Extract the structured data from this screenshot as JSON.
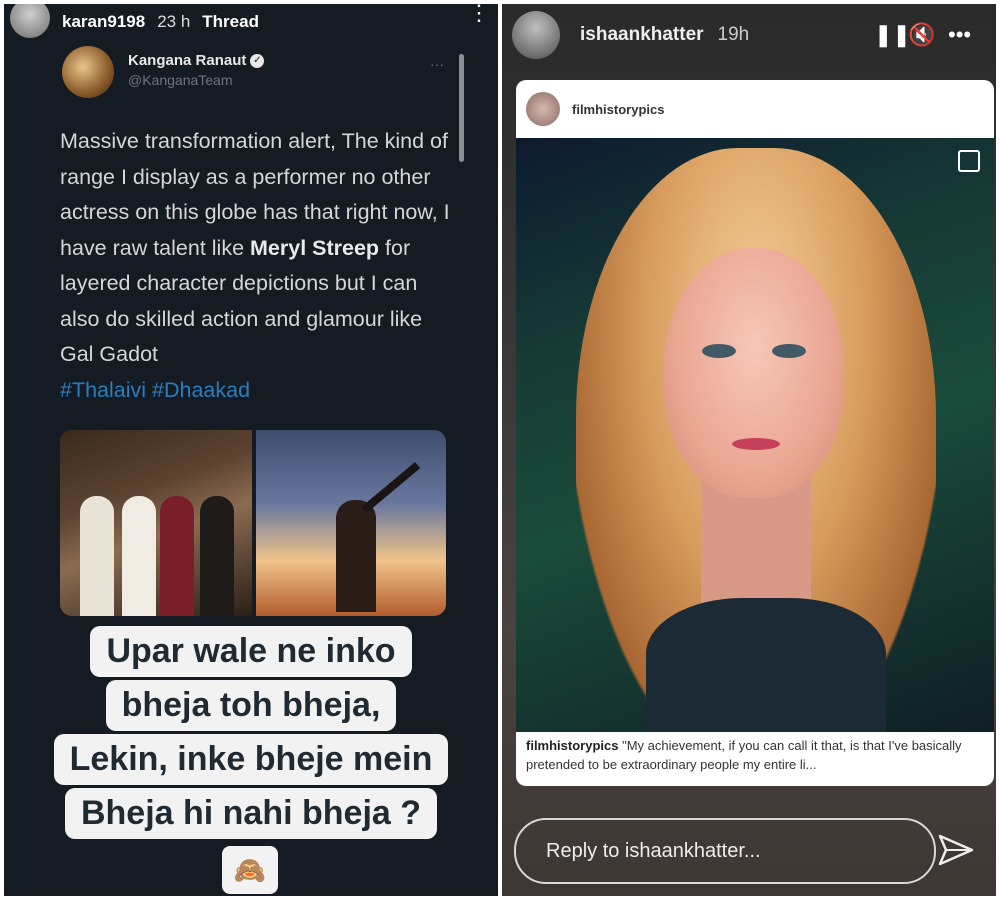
{
  "left_story": {
    "username": "karan9198",
    "time": "23 h",
    "label": "Thread",
    "menu_icon": "more-vertical-icon",
    "tweet": {
      "name": "Kangana Ranaut",
      "handle": "@KanganaTeam",
      "more": "···",
      "text_part1": "Massive transformation alert, The kind of range I display as a performer no other actress on this globe has that right now, I have raw talent like ",
      "bold": "Meryl Streep",
      "text_part2": " for layered character depictions but I can also do skilled action and glamour like Gal Gadot",
      "hashtags": "#Thalaivi #Dhaakad"
    },
    "caption_lines": [
      "Upar wale ne inko",
      "bheja toh bheja,",
      "Lekin, inke bheje mein",
      "Bheja hi nahi bheja ?"
    ],
    "emoji": "🙈"
  },
  "right_story": {
    "username": "ishaankhatter",
    "time": "19h",
    "pause_icon": "pause-icon",
    "mute_icon": "mute-icon",
    "more_icon": "more-horizontal-icon",
    "post": {
      "username": "filmhistorypics",
      "caption_user": "filmhistorypics",
      "caption_text": "\"My achievement, if you can call it that, is that I've basically pretended to be extraordinary people my entire li..."
    },
    "reply_placeholder": "Reply to ishaankhatter...",
    "send_icon": "send-icon"
  }
}
